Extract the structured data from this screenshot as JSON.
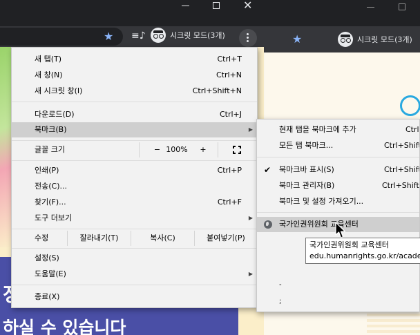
{
  "back_window": {
    "profile_label": "시크릿 모드(3개)"
  },
  "front_window": {
    "profile_label": "시크릿 모드(3개)",
    "close_glyph": "✕",
    "page_banner_line1": "정보",
    "page_banner_line2": "하실 수 있습니다"
  },
  "menu": {
    "items": {
      "new_tab": {
        "label": "새 탭(T)",
        "shortcut": "Ctrl+T"
      },
      "new_window": {
        "label": "새 창(N)",
        "shortcut": "Ctrl+N"
      },
      "new_incognito": {
        "label": "새 시크릿 창(I)",
        "shortcut": "Ctrl+Shift+N"
      },
      "downloads": {
        "label": "다운로드(D)",
        "shortcut": "Ctrl+J"
      },
      "bookmarks": {
        "label": "북마크(B)"
      },
      "font_size": {
        "label": "글꼴 크기"
      },
      "print": {
        "label": "인쇄(P)",
        "shortcut": "Ctrl+P"
      },
      "cast": {
        "label": "전송(C)..."
      },
      "find": {
        "label": "찾기(F)...",
        "shortcut": "Ctrl+F"
      },
      "more_tools": {
        "label": "도구 더보기"
      },
      "settings": {
        "label": "설정(S)"
      },
      "help": {
        "label": "도움말(E)"
      },
      "exit": {
        "label": "종료(X)"
      }
    },
    "zoom": {
      "minus": "−",
      "value": "100%",
      "plus": "+"
    },
    "edit": {
      "label": "수정",
      "cut": "잘라내기(T)",
      "copy": "복사(C)",
      "paste": "붙여넣기(P)"
    }
  },
  "submenu": {
    "bookmark_this_tab": {
      "label": "현재 탭을 북마크에 추가",
      "shortcut": "Ctrl+D"
    },
    "bookmark_all_tabs": {
      "label": "모든 탭 북마크...",
      "shortcut": "Ctrl+Shift+D"
    },
    "show_bookmarks_bar": {
      "label": "북마크바 표시(S)",
      "shortcut": "Ctrl+Shift+B",
      "checked": true
    },
    "bookmark_manager": {
      "label": "북마크 관리자(B)",
      "shortcut": "Ctrl+Shift+O"
    },
    "import": {
      "label": "북마크 및 설정 가져오기..."
    },
    "bookmark_item": {
      "label": "국가인권위원회 교육센터"
    },
    "trailing_1": "-",
    "trailing_2": ";"
  },
  "tooltip": {
    "title": "국가인권위원회 교육센터",
    "url": "edu.humanrights.go.kr/academy"
  },
  "colors": {
    "menu_bg": "#f2f2f2",
    "highlight": "#cfcfcf",
    "chrome_dark": "#202124",
    "toolbar": "#35363a",
    "accent_star": "#8ab4f8",
    "banner": "#4a4fa6"
  }
}
